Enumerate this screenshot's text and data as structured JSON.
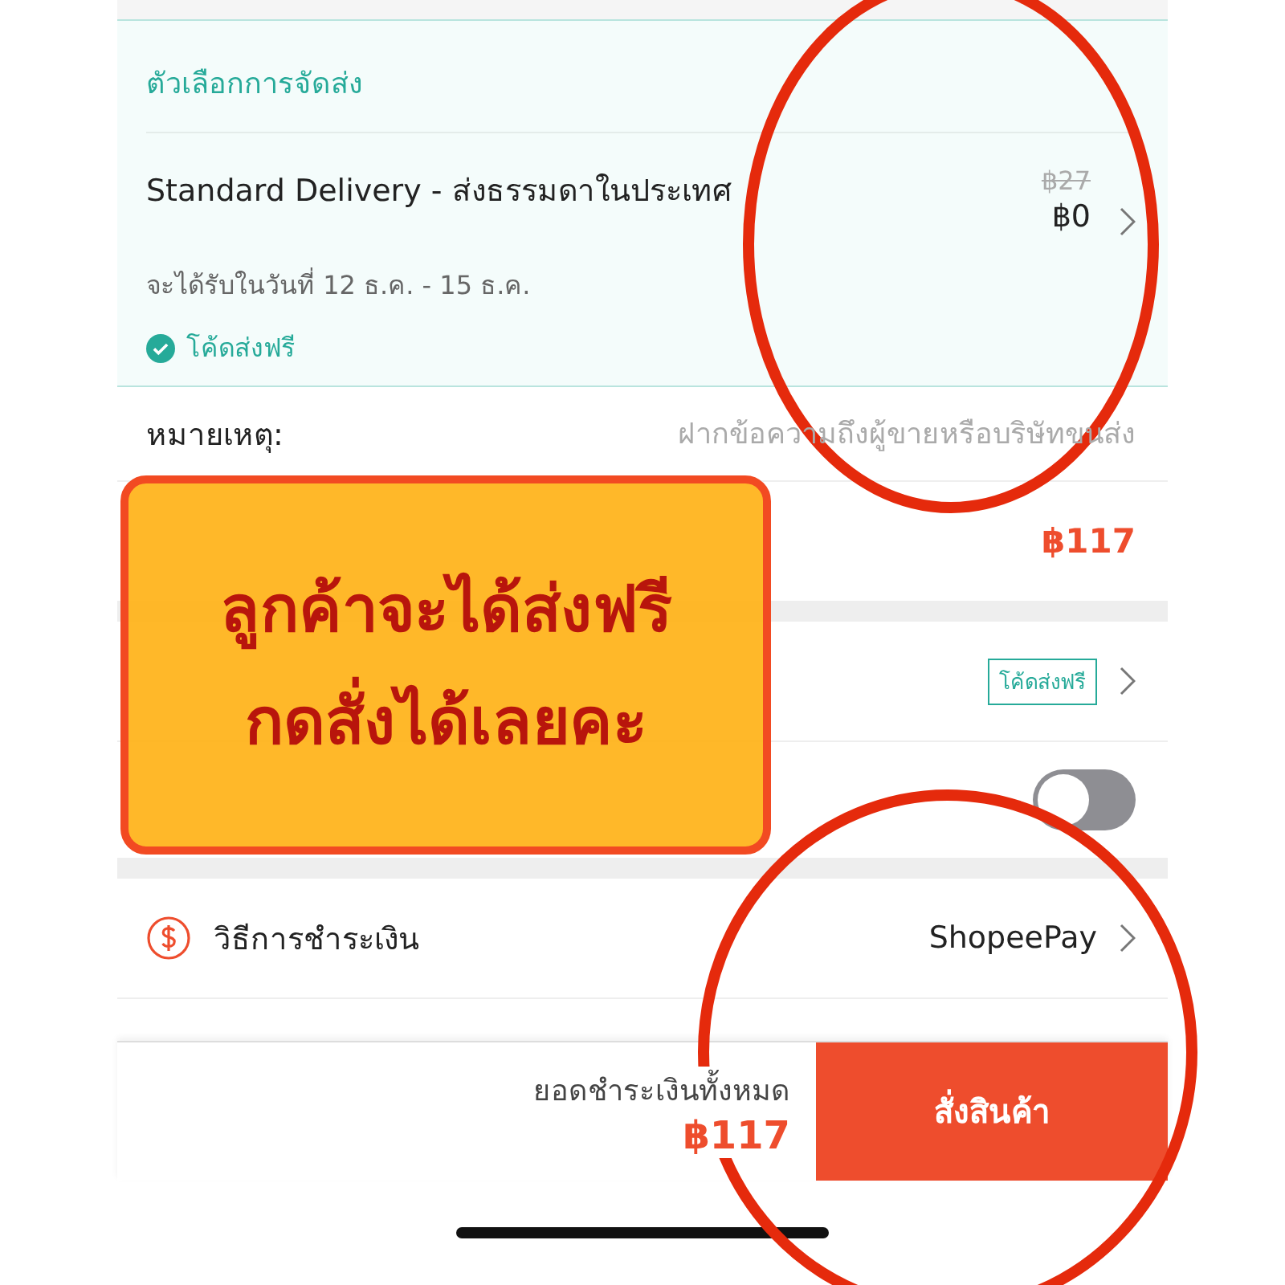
{
  "shipping": {
    "title": "ตัวเลือกการจัดส่ง",
    "option": "Standard Delivery - ส่งธรรมดาในประเทศ",
    "original_price": "฿27",
    "price": "฿0",
    "eta": "จะได้รับในวันที่ 12 ธ.ค. - 15 ธ.ค.",
    "free_shipping": "โค้ดส่งฟรี"
  },
  "note": {
    "label": "หมายเหตุ:",
    "placeholder": "ฝากข้อความถึงผู้ขายหรือบริษัทขนส่ง"
  },
  "order_total": {
    "amount": "฿117"
  },
  "voucher": {
    "tag": "โค้ดส่งฟรี"
  },
  "coins": {
    "on": false
  },
  "payment": {
    "label": "วิธีการชำระเงิน",
    "value": "ShopeePay"
  },
  "footer": {
    "total_label": "ยอดชำระเงินทั้งหมด",
    "total": "฿117",
    "button": "สั่งสินค้า"
  },
  "annotation": {
    "lines": [
      "ลูกค้าจะได้ส่งฟรี",
      "กดสั่งได้เลยคะ"
    ]
  }
}
